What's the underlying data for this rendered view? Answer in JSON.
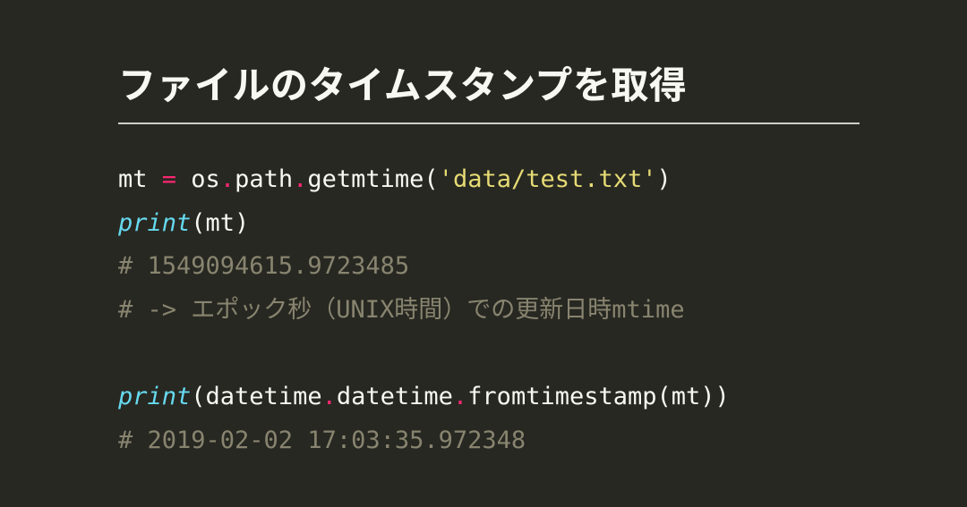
{
  "title": "ファイルのタイムスタンプを取得",
  "code": {
    "l1_a": "mt ",
    "l1_eq": "=",
    "l1_b": " os",
    "l1_dot1": ".",
    "l1_c": "path",
    "l1_dot2": ".",
    "l1_d": "getmtime(",
    "l1_str": "'data/test.txt'",
    "l1_e": ")",
    "l2_print": "print",
    "l2_rest": "(mt)",
    "l3_comment": "# 1549094615.9723485",
    "l4_comment": "# -> エポック秒（UNIX時間）での更新日時mtime",
    "blank": "",
    "l6_print": "print",
    "l6_a": "(datetime",
    "l6_dot1": ".",
    "l6_b": "datetime",
    "l6_dot2": ".",
    "l6_c": "fromtimestamp(mt))",
    "l7_comment": "# 2019-02-02 17:03:35.972348"
  }
}
